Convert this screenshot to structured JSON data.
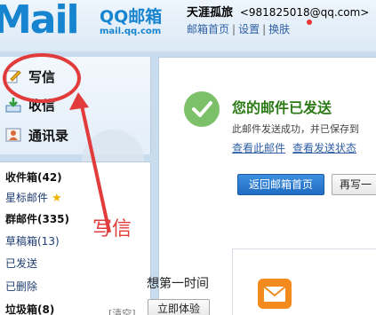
{
  "header": {
    "logo_text": "Mail",
    "logo_brand": "QQ邮箱",
    "logo_domain": "mail.qq.com",
    "user_name": "天涯孤旅",
    "user_email": "<981825018@qq.com>",
    "links": [
      "邮箱首页",
      "设置",
      "换肤"
    ],
    "separator": "|"
  },
  "sidebar": {
    "primary": [
      {
        "label": "写信",
        "icon": "pencil-icon"
      },
      {
        "label": "收信",
        "icon": "inbox-download-icon"
      },
      {
        "label": "通讯录",
        "icon": "contacts-icon"
      }
    ],
    "folders": [
      {
        "label": "收件箱(42)",
        "bold": true
      },
      {
        "label": "星标邮件",
        "bold": false,
        "star": "★"
      },
      {
        "label": "群邮件(335)",
        "bold": true
      },
      {
        "label": "草稿箱(13)",
        "bold": false
      },
      {
        "label": "已发送",
        "bold": false
      },
      {
        "label": "已删除",
        "bold": false
      },
      {
        "label": "垃圾箱(8)",
        "bold": true
      }
    ],
    "clear_label": "[清空]"
  },
  "main": {
    "title": "您的邮件已发送",
    "description": "此邮件发送成功，并已保存到",
    "links": [
      "查看此邮件",
      "查看发送状态"
    ],
    "primary_button": "返回邮箱首页",
    "secondary_button": "再写一",
    "promo_text": "想第一时间",
    "promo_button": "立即体验"
  },
  "annotation": {
    "label": "写信",
    "color": "#e23b3b"
  }
}
